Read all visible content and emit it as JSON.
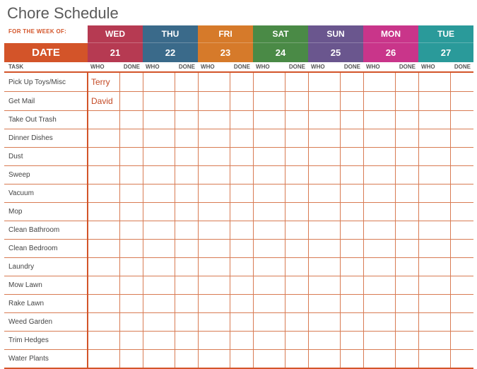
{
  "title": "Chore Schedule",
  "for_week_label": "FOR THE WEEK OF:",
  "date_label": "DATE",
  "task_header": "TASK",
  "who_header": "WHO",
  "done_header": "DONE",
  "days": [
    {
      "name": "WED",
      "num": "21",
      "color": "c0"
    },
    {
      "name": "THU",
      "num": "22",
      "color": "c1"
    },
    {
      "name": "FRI",
      "num": "23",
      "color": "c2"
    },
    {
      "name": "SAT",
      "num": "24",
      "color": "c3"
    },
    {
      "name": "SUN",
      "num": "25",
      "color": "c4"
    },
    {
      "name": "MON",
      "num": "26",
      "color": "c5"
    },
    {
      "name": "TUE",
      "num": "27",
      "color": "c6"
    }
  ],
  "tasks": [
    {
      "name": "Pick Up Toys/Misc",
      "cells": [
        "Terry",
        "",
        "",
        "",
        "",
        "",
        "",
        "",
        "",
        "",
        "",
        "",
        "",
        ""
      ]
    },
    {
      "name": "Get Mail",
      "cells": [
        "David",
        "",
        "",
        "",
        "",
        "",
        "",
        "",
        "",
        "",
        "",
        "",
        "",
        ""
      ]
    },
    {
      "name": "Take Out Trash",
      "cells": [
        "",
        "",
        "",
        "",
        "",
        "",
        "",
        "",
        "",
        "",
        "",
        "",
        "",
        ""
      ]
    },
    {
      "name": "Dinner Dishes",
      "cells": [
        "",
        "",
        "",
        "",
        "",
        "",
        "",
        "",
        "",
        "",
        "",
        "",
        "",
        ""
      ]
    },
    {
      "name": "Dust",
      "cells": [
        "",
        "",
        "",
        "",
        "",
        "",
        "",
        "",
        "",
        "",
        "",
        "",
        "",
        ""
      ]
    },
    {
      "name": "Sweep",
      "cells": [
        "",
        "",
        "",
        "",
        "",
        "",
        "",
        "",
        "",
        "",
        "",
        "",
        "",
        ""
      ]
    },
    {
      "name": "Vacuum",
      "cells": [
        "",
        "",
        "",
        "",
        "",
        "",
        "",
        "",
        "",
        "",
        "",
        "",
        "",
        ""
      ]
    },
    {
      "name": "Mop",
      "cells": [
        "",
        "",
        "",
        "",
        "",
        "",
        "",
        "",
        "",
        "",
        "",
        "",
        "",
        ""
      ]
    },
    {
      "name": "Clean Bathroom",
      "cells": [
        "",
        "",
        "",
        "",
        "",
        "",
        "",
        "",
        "",
        "",
        "",
        "",
        "",
        ""
      ]
    },
    {
      "name": "Clean Bedroom",
      "cells": [
        "",
        "",
        "",
        "",
        "",
        "",
        "",
        "",
        "",
        "",
        "",
        "",
        "",
        ""
      ]
    },
    {
      "name": "Laundry",
      "cells": [
        "",
        "",
        "",
        "",
        "",
        "",
        "",
        "",
        "",
        "",
        "",
        "",
        "",
        ""
      ]
    },
    {
      "name": "Mow Lawn",
      "cells": [
        "",
        "",
        "",
        "",
        "",
        "",
        "",
        "",
        "",
        "",
        "",
        "",
        "",
        ""
      ]
    },
    {
      "name": "Rake Lawn",
      "cells": [
        "",
        "",
        "",
        "",
        "",
        "",
        "",
        "",
        "",
        "",
        "",
        "",
        "",
        ""
      ]
    },
    {
      "name": "Weed Garden",
      "cells": [
        "",
        "",
        "",
        "",
        "",
        "",
        "",
        "",
        "",
        "",
        "",
        "",
        "",
        ""
      ]
    },
    {
      "name": "Trim Hedges",
      "cells": [
        "",
        "",
        "",
        "",
        "",
        "",
        "",
        "",
        "",
        "",
        "",
        "",
        "",
        ""
      ]
    },
    {
      "name": "Water Plants",
      "cells": [
        "",
        "",
        "",
        "",
        "",
        "",
        "",
        "",
        "",
        "",
        "",
        "",
        "",
        ""
      ]
    }
  ]
}
